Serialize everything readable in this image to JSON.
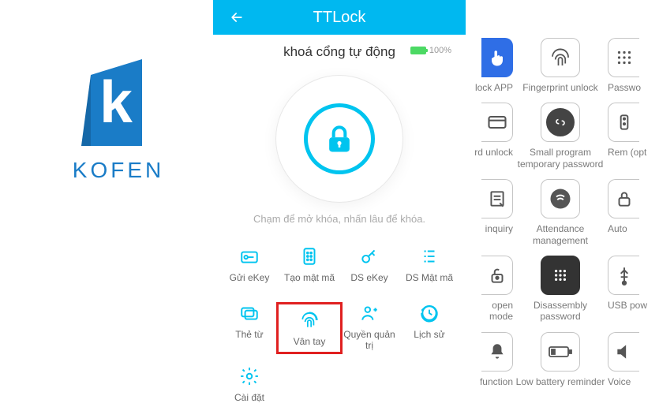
{
  "logo": {
    "brand": "KOFEN"
  },
  "header": {
    "title": "TTLock"
  },
  "lock": {
    "name": "khoá cổng tự động",
    "battery_pct": "100%",
    "hint": "Chạm để mở khóa, nhấn lâu để khóa."
  },
  "grid": {
    "r1c1": "Gửi eKey",
    "r1c2": "Tạo mật mã",
    "r1c3": "DS eKey",
    "r1c4": "DS Mật mã",
    "r2c1": "Thẻ từ",
    "r2c2": "Vân tay",
    "r2c3": "Quyền quản trị",
    "r2c4": "Lịch sử",
    "r3c1": "Cài đặt"
  },
  "side": {
    "r1c1": "lock APP",
    "r1c2": "Fingerprint unlock",
    "r1c3": "Passwo",
    "r2c1": "rd unlock",
    "r2c2": "Small program temporary password",
    "r2c3": "Rem (opt",
    "r3c1": "inquiry",
    "r3c2": "Attendance management",
    "r3c3": "Auto",
    "r4c1": "open mode",
    "r4c2": "Disassembly password",
    "r4c3": "USB pow",
    "r5c1": "function",
    "r5c2": "Low battery reminder",
    "r5c3": "Voice"
  },
  "colors": {
    "accent": "#00c4ef",
    "brand": "#1a7cc7"
  }
}
